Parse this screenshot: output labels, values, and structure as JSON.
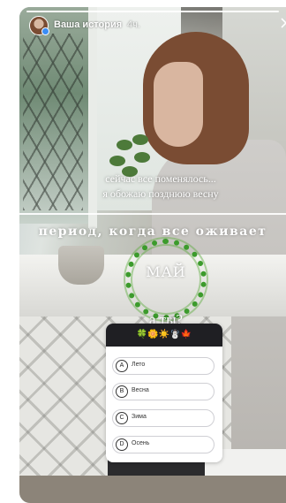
{
  "story": {
    "header": {
      "title": "Ваша история",
      "time": "4ч."
    },
    "caption": {
      "line1": "сейчас все поменялось...",
      "line2": "я обожаю позднюю весну"
    },
    "banner": "период, когда все оживает",
    "wreath_word": "МАЙ",
    "question": "а ты?",
    "quiz": {
      "emoji_row": "🍀🌼☀️☃️🍁",
      "options": [
        {
          "letter": "A",
          "label": "Лето"
        },
        {
          "letter": "B",
          "label": "Весна"
        },
        {
          "letter": "C",
          "label": "Зима"
        },
        {
          "letter": "D",
          "label": "Осень"
        }
      ]
    }
  },
  "colors": {
    "quiz_header": "#1f1f23",
    "wreath_green": "#3c9b2c",
    "avatar_badge": "#3a8df5"
  }
}
